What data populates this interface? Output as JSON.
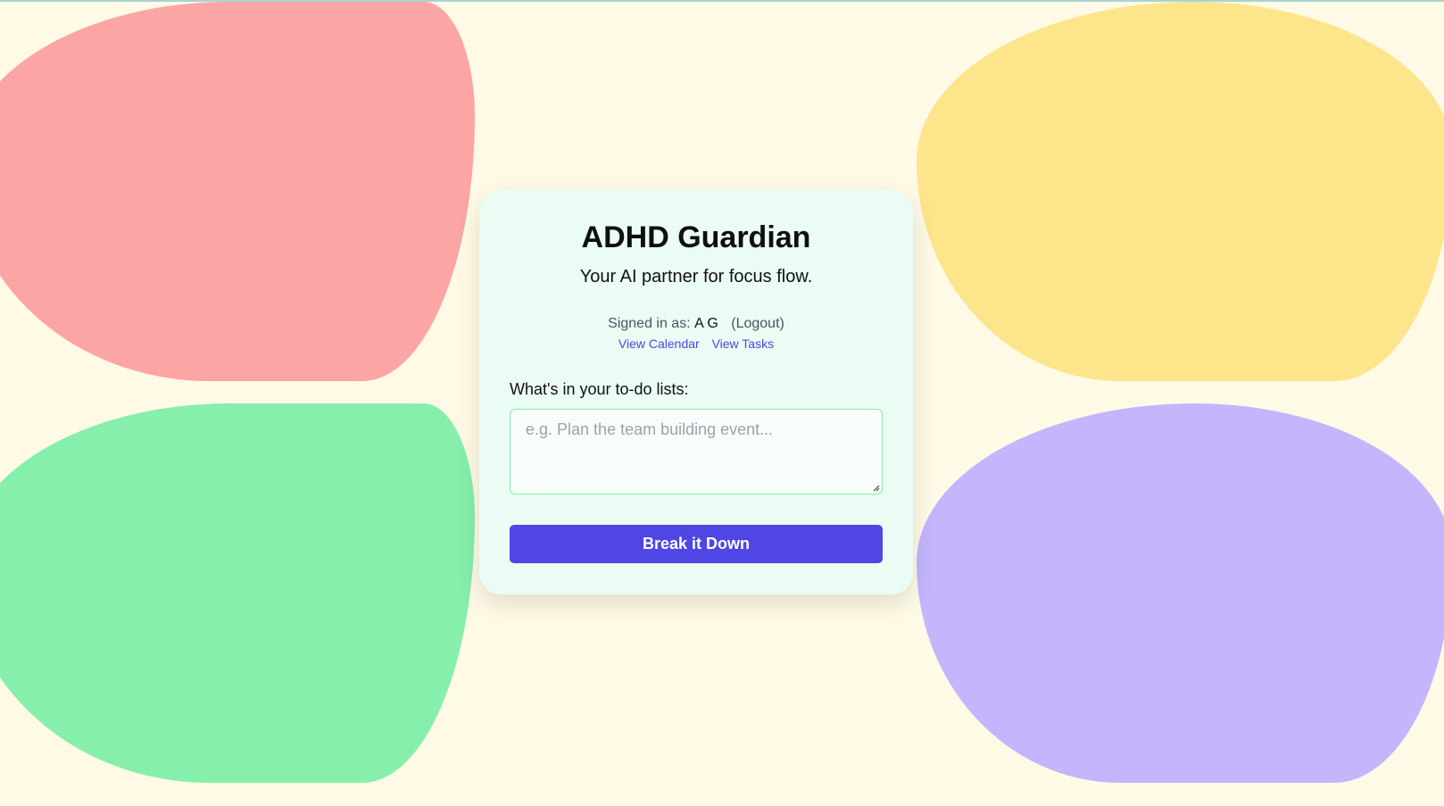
{
  "app": {
    "title": "ADHD Guardian",
    "subtitle": "Your AI partner for focus flow."
  },
  "auth": {
    "signed_in_label": "Signed in as:",
    "user_name": "A G",
    "logout_label": "(Logout)"
  },
  "nav": {
    "calendar_label": "View Calendar",
    "tasks_label": "View Tasks"
  },
  "form": {
    "label": "What's in your to-do lists:",
    "placeholder": "e.g. Plan the team building event...",
    "value": "",
    "submit_label": "Break it Down"
  },
  "colors": {
    "background": "#fefae6",
    "card": "#eafcf3",
    "accent": "#4f46e5",
    "blob_red": "#fca5a5",
    "blob_yellow": "#fde58c",
    "blob_green": "#86efac",
    "blob_purple": "#c4b5fd"
  }
}
